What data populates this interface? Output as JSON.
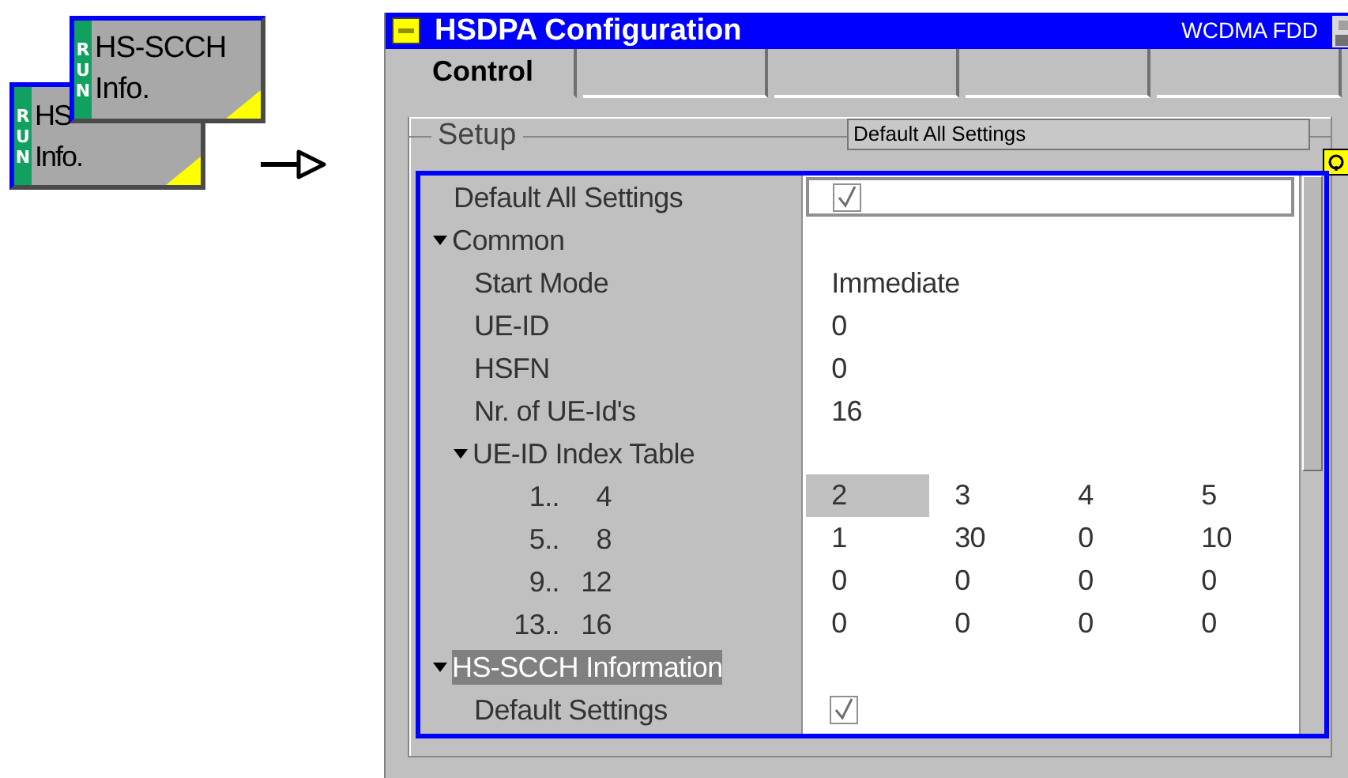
{
  "softkeys": [
    {
      "status": "RUN",
      "lines": [
        "HS",
        "Info."
      ]
    },
    {
      "status": "RUN",
      "lines": [
        "HS-SCCH",
        "Info."
      ]
    }
  ],
  "window": {
    "title": "HSDPA Configuration",
    "mode": "WCDMA FDD"
  },
  "tabs": [
    {
      "label": "Control",
      "selected": true
    },
    {
      "selected": false
    },
    {
      "selected": false
    },
    {
      "selected": false
    },
    {
      "selected": false
    }
  ],
  "group": {
    "title": "Setup",
    "dropdown": "Default All Settings"
  },
  "settings": [
    {
      "kind": "field_checkbox",
      "label": "Default All Settings",
      "checked": true
    },
    {
      "kind": "group",
      "label": "Common",
      "expanded": true,
      "selected": false,
      "children": [
        {
          "kind": "text",
          "label": "Start Mode",
          "value": "Immediate"
        },
        {
          "kind": "text",
          "label": "UE-ID",
          "value": "0"
        },
        {
          "kind": "text",
          "label": "HSFN",
          "value": "0"
        },
        {
          "kind": "text",
          "label": "Nr. of UE-Id's",
          "value": "16"
        },
        {
          "kind": "group",
          "label": "UE-ID Index Table",
          "expanded": true,
          "selected": false,
          "children": [
            {
              "kind": "index",
              "from": "1..",
              "to": "4",
              "cells": [
                {
                  "value": "2",
                  "selected": true
                },
                {
                  "value": "3",
                  "selected": false
                },
                {
                  "value": "4",
                  "selected": false
                },
                {
                  "value": "5",
                  "selected": false
                }
              ]
            },
            {
              "kind": "index",
              "from": "5..",
              "to": "8",
              "cells": [
                {
                  "value": "1",
                  "selected": false
                },
                {
                  "value": "30",
                  "selected": false
                },
                {
                  "value": "0",
                  "selected": false
                },
                {
                  "value": "10",
                  "selected": false
                }
              ]
            },
            {
              "kind": "index",
              "from": "9..",
              "to": "12",
              "cells": [
                {
                  "value": "0",
                  "selected": false
                },
                {
                  "value": "0",
                  "selected": false
                },
                {
                  "value": "0",
                  "selected": false
                },
                {
                  "value": "0",
                  "selected": false
                }
              ]
            },
            {
              "kind": "index",
              "from": "13..",
              "to": "16",
              "cells": [
                {
                  "value": "0",
                  "selected": false
                },
                {
                  "value": "0",
                  "selected": false
                },
                {
                  "value": "0",
                  "selected": false
                },
                {
                  "value": "0",
                  "selected": false
                }
              ]
            }
          ]
        }
      ]
    },
    {
      "kind": "group",
      "label": "HS-SCCH Information",
      "expanded": true,
      "selected": true,
      "children": [
        {
          "kind": "checkbox",
          "label": "Default Settings",
          "checked": true
        }
      ]
    }
  ]
}
